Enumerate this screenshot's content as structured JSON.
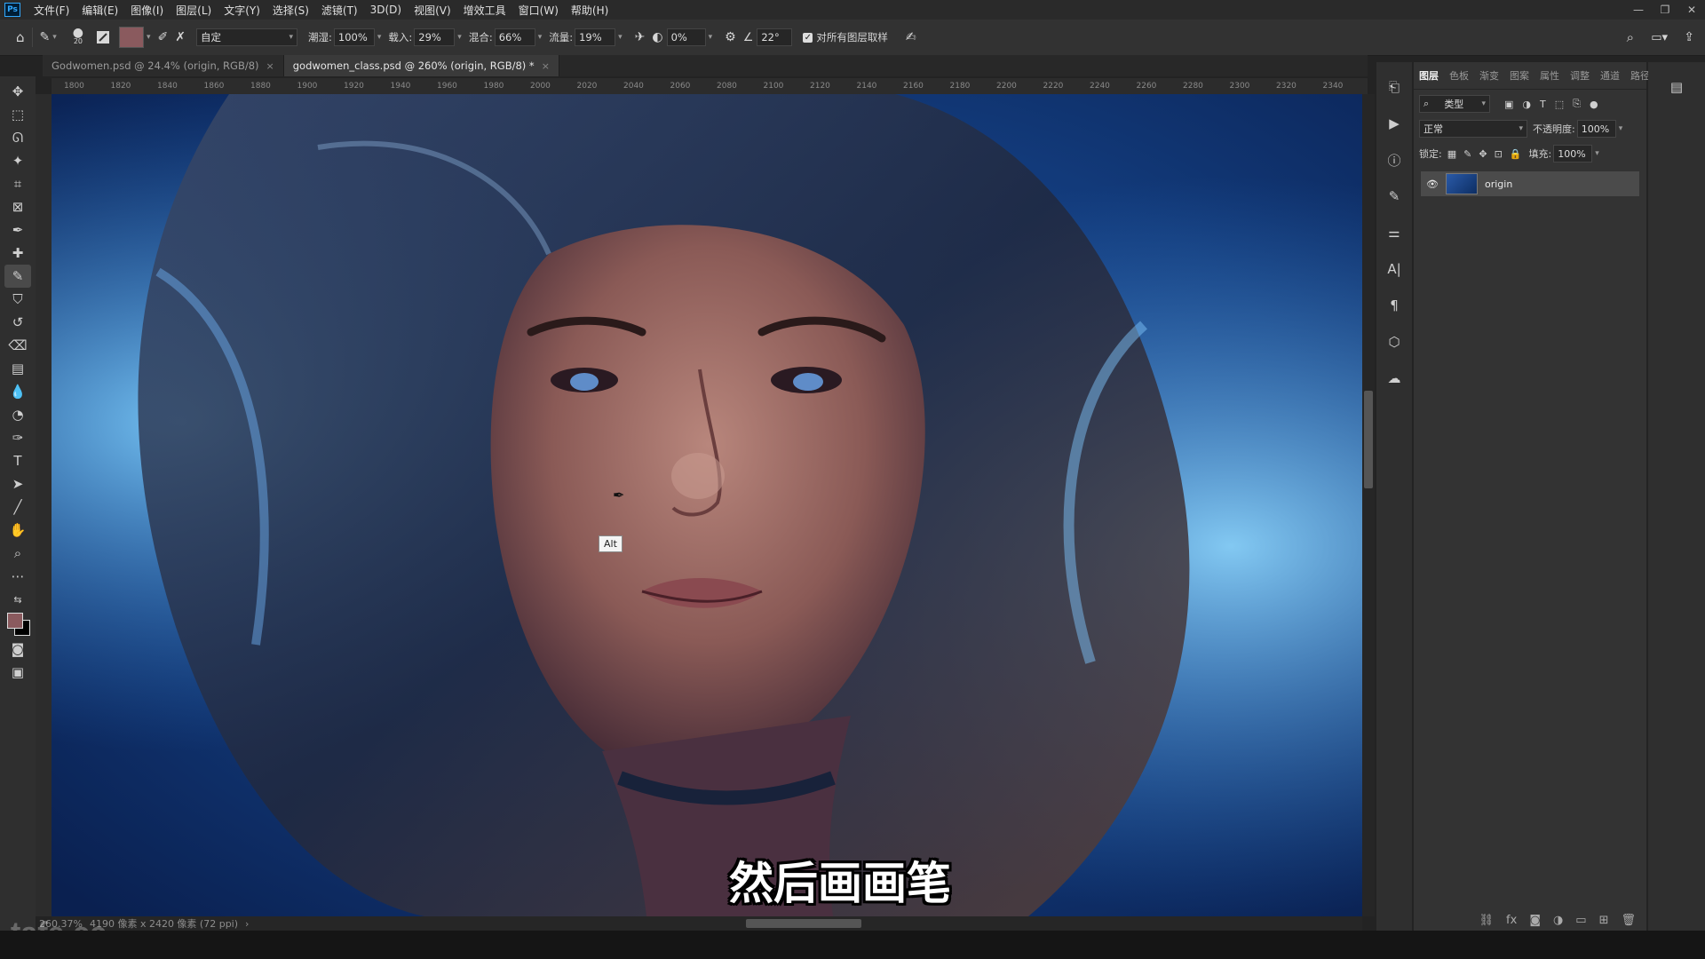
{
  "app": {
    "logo": "Ps"
  },
  "menu": [
    "文件(F)",
    "编辑(E)",
    "图像(I)",
    "图层(L)",
    "文字(Y)",
    "选择(S)",
    "滤镜(T)",
    "3D(D)",
    "视图(V)",
    "增效工具",
    "窗口(W)",
    "帮助(H)"
  ],
  "window_controls": [
    "—",
    "❐",
    "✕"
  ],
  "options": {
    "brush_size": "20",
    "preset": "自定",
    "wet_label": "潮湿:",
    "wet": "100%",
    "load_label": "载入:",
    "load": "29%",
    "mix_label": "混合:",
    "mix": "66%",
    "flow_label": "流量:",
    "flow": "19%",
    "smooth": "0%",
    "angle": "22°",
    "sample_all_label": "对所有图层取样",
    "foreground_color": "#8a5a5e"
  },
  "tabs": [
    {
      "label": "Godwomen.psd @ 24.4% (origin, RGB/8)",
      "close": "×"
    },
    {
      "label": "godwomen_class.psd @ 260% (origin, RGB/8) *",
      "close": "×"
    }
  ],
  "ruler_ticks": [
    "1800",
    "1820",
    "1840",
    "1860",
    "1880",
    "1900",
    "1920",
    "1940",
    "1960",
    "1980",
    "2000",
    "2020",
    "2040",
    "2060",
    "2080",
    "2100",
    "2120",
    "2140",
    "2160",
    "2180",
    "2200",
    "2220",
    "2240",
    "2260",
    "2280",
    "2300",
    "2320",
    "2340"
  ],
  "tooltip": "Alt",
  "subtitle": "然后画画笔",
  "status": {
    "zoom": "260.37%",
    "doc_info": "4190 像素 x 2420 像素 (72 ppi)"
  },
  "watermark": "tafe.cc",
  "layers_panel": {
    "tabs": [
      "图层",
      "色板",
      "渐变",
      "图案",
      "属性",
      "调整",
      "通道",
      "路径"
    ],
    "filter_label": "类型",
    "blend_mode": "正常",
    "opacity_label": "不透明度:",
    "opacity": "100%",
    "lock_label": "锁定:",
    "fill_label": "填充:",
    "fill": "100%",
    "layer_name": "origin"
  }
}
